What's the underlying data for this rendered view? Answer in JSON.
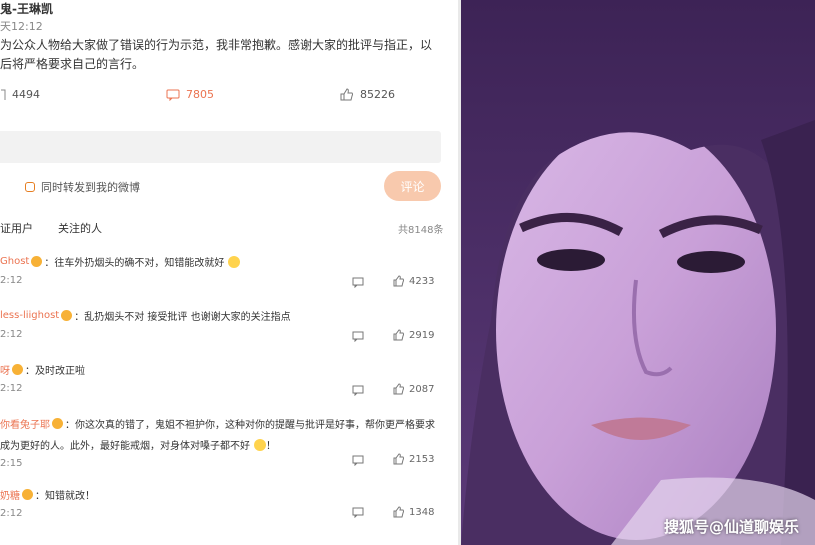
{
  "post": {
    "author": "鬼-王琳凯",
    "time": "天12:12",
    "text": "为公众人物给大家做了错误的行为示范，我非常抱歉。感谢大家的批评与指正，以后将严格要求自己的言行。",
    "reposts": "4494",
    "comments": "7805",
    "likes": "85226"
  },
  "composer": {
    "forward_label": "同时转发到我的微博",
    "submit_label": "评论"
  },
  "filters": {
    "verified": "证用户",
    "following": "关注的人",
    "total": "共8148条"
  },
  "comments": [
    {
      "name": "Ghost",
      "text": "：往车外扔烟头的确不对，知错能改就好",
      "time": "2:12",
      "likes": "4233"
    },
    {
      "name": "less-liighost",
      "text": "：乱扔烟头不对 接受批评 也谢谢大家的关注指点",
      "time": "2:12",
      "likes": "2919"
    },
    {
      "name": "呀",
      "text": "：及时改正啦",
      "time": "2:12",
      "likes": "2087"
    },
    {
      "name": "你看兔子耶",
      "text": "：你这次真的错了，鬼姐不袒护你，这种对你的提醒与批评是好事，帮你更严格要求",
      "text2": "成为更好的人。此外，最好能戒烟，对身体对嗓子都不好",
      "time": "2:15",
      "likes": "2153"
    },
    {
      "name": "奶糖",
      "text": "：知错就改！",
      "time": "2:12",
      "likes": "1348"
    },
    {
      "name": "",
      "text": "",
      "time": "",
      "likes": ""
    }
  ],
  "watermark": "搜狐号@仙道聊娱乐",
  "colors": {
    "accent": "#eb7350",
    "button": "#f8c9ad",
    "badge": "#f7b136"
  }
}
